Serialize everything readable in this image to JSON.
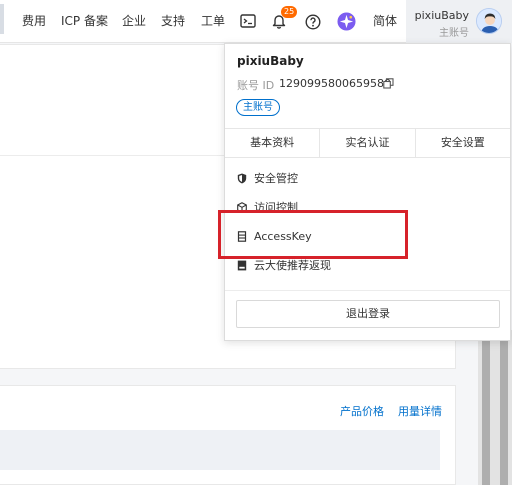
{
  "topnav": {
    "items": [
      "费用",
      "ICP 备案",
      "企业",
      "支持",
      "工单"
    ],
    "notification_count": "25",
    "language": "简体",
    "user_name": "pixiuBaby",
    "user_role": "主账号"
  },
  "page": {
    "links": [
      "产品价格",
      "用量详情"
    ]
  },
  "dropdown": {
    "user_name": "pixiuBaby",
    "account_id_label": "账号 ID",
    "account_id": "1290995800659580",
    "tag": "主账号",
    "tabs": [
      "基本资料",
      "实名认证",
      "安全设置"
    ],
    "menu": [
      {
        "label": "安全管控",
        "icon": "shield-icon"
      },
      {
        "label": "访问控制",
        "icon": "access-control-icon"
      },
      {
        "label": "AccessKey",
        "icon": "key-icon"
      },
      {
        "label": "云大使推荐返现",
        "icon": "book-icon"
      }
    ],
    "logout": "退出登录"
  },
  "colors": {
    "accent": "#0070cc",
    "highlight": "#d6222a",
    "badge": "#ff6a00"
  }
}
